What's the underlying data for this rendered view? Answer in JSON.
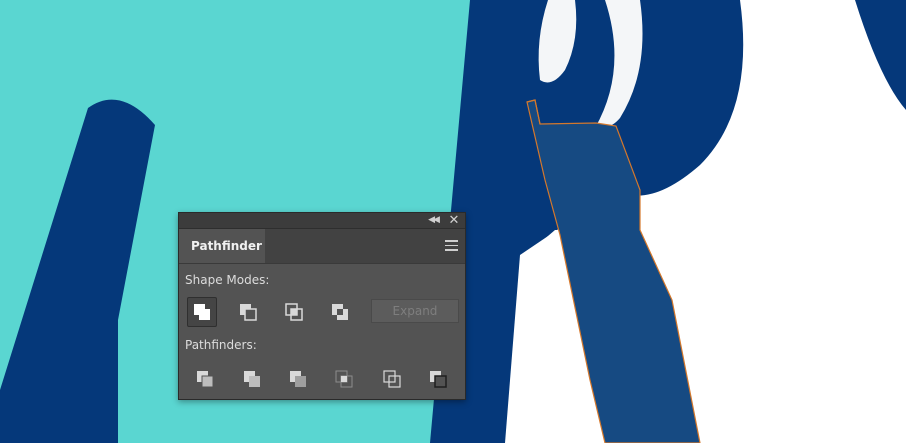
{
  "colors": {
    "background_teal": "#5ad6d1",
    "letter_navy": "#05387a",
    "selected_shape": "#164a82",
    "selection_outline": "#d4782c",
    "white_area": "#ffffff",
    "panel_bg": "#535353"
  },
  "panel": {
    "tab_label": "Pathfinder",
    "collapse_icon": "double-chevron-left-icon",
    "close_icon": "close-icon",
    "menu_icon": "hamburger-menu-icon",
    "shape_modes_label": "Shape Modes:",
    "pathfinders_label": "Pathfinders:",
    "expand_label": "Expand",
    "shape_modes": [
      {
        "name": "unite",
        "active": true
      },
      {
        "name": "minus-front",
        "active": false
      },
      {
        "name": "intersect",
        "active": false
      },
      {
        "name": "exclude",
        "active": false
      }
    ],
    "pathfinders": [
      {
        "name": "divide"
      },
      {
        "name": "trim"
      },
      {
        "name": "merge"
      },
      {
        "name": "crop"
      },
      {
        "name": "outline"
      },
      {
        "name": "minus-back"
      }
    ]
  }
}
